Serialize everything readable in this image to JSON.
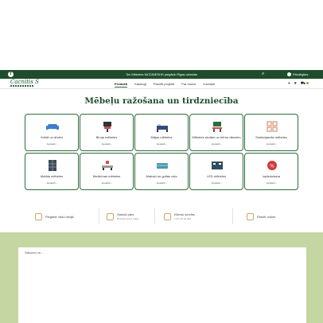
{
  "topbar": {
    "facebook_icon": "facebook-icon",
    "promo": "Tev Mēbeles MCDINESHS piegāde Rīgas robežās",
    "search_icon": "search-icon",
    "user_label": "Pieslēgties"
  },
  "header": {
    "logo": "Cacnitis S",
    "nav": [
      {
        "label": "Produkti"
      },
      {
        "label": "Katalogi"
      },
      {
        "label": "Pasūtīt projekti"
      },
      {
        "label": "Par mums"
      },
      {
        "label": "Kontakti"
      }
    ],
    "icons": [
      "location-icon",
      "heart-icon",
      "cart-icon"
    ]
  },
  "main": {
    "title": "Mēbeļu ražošana un tirdzniecība",
    "more_label": "Apskatīt ›",
    "categories": [
      {
        "label": "Krēsli un dīvāni",
        "icon": "sofa-icon",
        "color": "#3a7fd0"
      },
      {
        "label": "Biroja mēbeles",
        "icon": "office-chair-icon",
        "color": "#c85050"
      },
      {
        "label": "Mājas mēbeles",
        "icon": "bed-icon",
        "color": "#2f4d80"
      },
      {
        "label": "Mēbeles skolām un bērnu dārziem",
        "icon": "school-desk-icon",
        "color": "#d05050"
      },
      {
        "label": "Selekcijamās mēbeles",
        "icon": "modules-icon",
        "color": "#d08060"
      },
      {
        "label": "Metāla mēbeles",
        "icon": "metal-cabinet-icon",
        "color": "#3a4a5a"
      },
      {
        "label": "Medicīnas mēbeles",
        "icon": "medical-bed-icon",
        "color": "#d05050"
      },
      {
        "label": "Matrači un gultas veļa",
        "icon": "mattress-icon",
        "color": "#4a9ab0"
      },
      {
        "label": "LED mēbeles",
        "icon": "led-icon",
        "color": "#2f4d60"
      },
      {
        "label": "Izpārdošana",
        "icon": "sale-icon",
        "color": "#d03a3a"
      }
    ]
  },
  "features": [
    {
      "title": "Piegāde visā Latvijā",
      "sub": "",
      "icon": "delivery-icon"
    },
    {
      "title": "Salonā pārs",
      "sub": "Brīvības iela 5, Rīgā",
      "icon": "store-icon"
    },
    {
      "title": "Klientu serviss",
      "sub": "+371 00 00 000",
      "icon": "service-icon"
    },
    {
      "title": "Pasūtī online",
      "sub": "",
      "icon": "phone-icon"
    }
  ],
  "bottom": {
    "panel_text": "Sākums un ..."
  }
}
